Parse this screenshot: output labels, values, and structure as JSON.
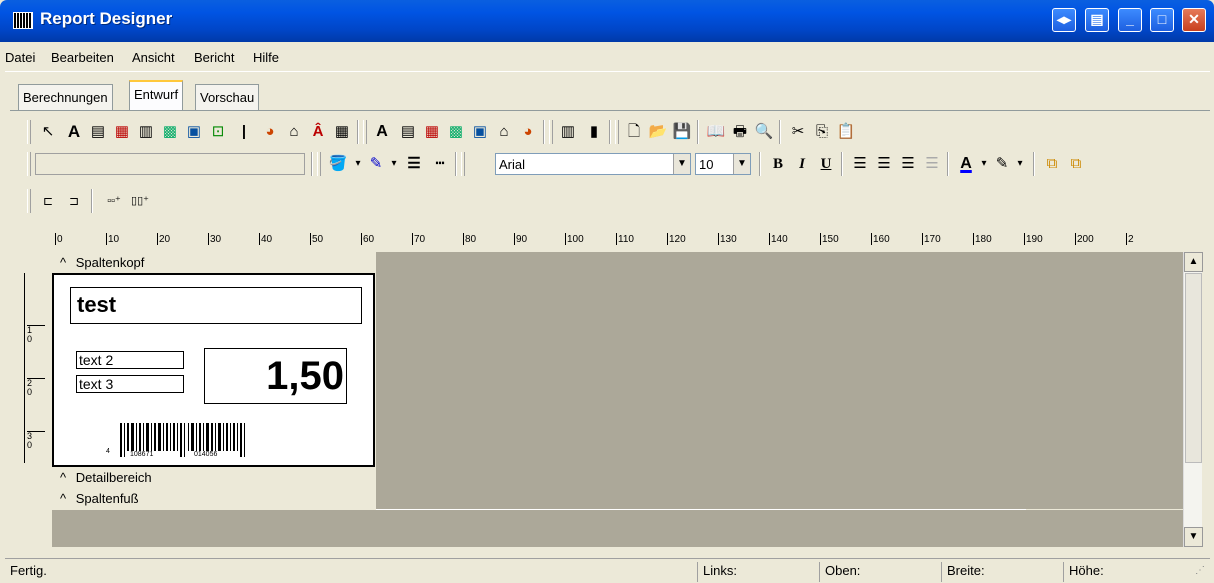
{
  "window": {
    "title": "Report Designer"
  },
  "menu": [
    "Datei",
    "Bearbeiten",
    "Ansicht",
    "Bericht",
    "Hilfe"
  ],
  "tabs": [
    "Berechnungen",
    "Entwurf",
    "Vorschau"
  ],
  "format": {
    "font": "Arial",
    "size": "10",
    "bold": "B",
    "italic": "I",
    "underline": "U",
    "font_color": "A"
  },
  "ruler": [
    "0",
    "10",
    "20",
    "30",
    "40",
    "50",
    "60",
    "70",
    "80",
    "90",
    "100",
    "110",
    "120",
    "130",
    "140",
    "150",
    "160",
    "170",
    "180",
    "190",
    "200",
    "2"
  ],
  "vruler": [
    "1\n0",
    "2\n0",
    "3\n0"
  ],
  "bands": {
    "header": "Spaltenkopf",
    "detail": "Detailbereich",
    "footer": "Spaltenfuß",
    "marker": "^"
  },
  "report": {
    "title": "test",
    "text2": "text 2",
    "text3": "text 3",
    "value": "1,50",
    "barcode": {
      "left": "4",
      "mid": "108671",
      "right": "014056"
    }
  },
  "status": {
    "text": "Fertig.",
    "links": "Links:",
    "oben": "Oben:",
    "breite": "Breite:",
    "hoehe": "Höhe:"
  }
}
